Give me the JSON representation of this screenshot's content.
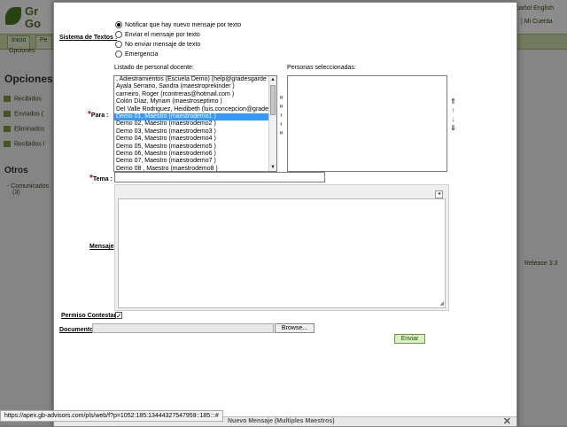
{
  "background": {
    "logo_line1": "Gr",
    "logo_line2": "Go",
    "nav_tabs": [
      "Inicio",
      "Pe"
    ],
    "subnav": "Opciones",
    "heading": "Opciones",
    "side_items": [
      "Recibidos",
      "Enviados (",
      "Eliminados",
      "Recibidos l"
    ],
    "others_heading": "Otros",
    "others_item": "Comunicados",
    "others_count": "(3)",
    "lang_links": "pañol  English",
    "account_link": "| Mi Cuenta",
    "release": "Release 3.3"
  },
  "modal": {
    "sms_label": "Sistema de Textos :",
    "sms_options": [
      {
        "label": "Notificar que hay nuevo mensaje por texto",
        "selected": true
      },
      {
        "label": "Enviar el mensaje por texto",
        "selected": false
      },
      {
        "label": "No enviar mensaje de texto",
        "selected": false
      },
      {
        "label": "Emergencia",
        "selected": false
      }
    ],
    "staff_list_label": "Listado de personal docente:",
    "selected_list_label": "Personas seleccionadas:",
    "to_label": "Para :",
    "staff": [
      ", Adiestramientos (Escuela Demo) (help@gradesgarde",
      "Ayala Serrano, Sandra (maestroprekinder )",
      "carneiro, Roger (rcontreras@hotmail.com )",
      "Colón Díaz, Myriam (maestroseptimo )",
      "Del Valle Rodriguez, Heidibeth (luis.concepcion@grade",
      "Demo 01, Maestro (maestrodemo1 )",
      "Demo 02, Maestro (maestrodemo2 )",
      "Demo 03, Maestro (maestrodemo3 )",
      "Demo 04, Maestro (maestrodemo4 )",
      "Demo 05, Maestro (maestrodemo5 )",
      "Demo 06, Maestro (maestrodemo6 )",
      "Demo 07, Maestro (maestrodemo7 )",
      "Demo 08 , Maestro (maestrodemo8 )"
    ],
    "selected_index": 5,
    "subject_label": "Tema :",
    "message_label": "Mensaje",
    "reply_label": "Permiso Contestar",
    "reply_checked": true,
    "document_label": "Documento",
    "browse_label": "Browse...",
    "send_label": "Enviar",
    "window_title": "Nuevo Mensaje (Multiples Maestros)"
  },
  "status_url": "https://apex.gb-advisors.com/pls/web/f?p=1052:185:13444327547959::185:::#"
}
